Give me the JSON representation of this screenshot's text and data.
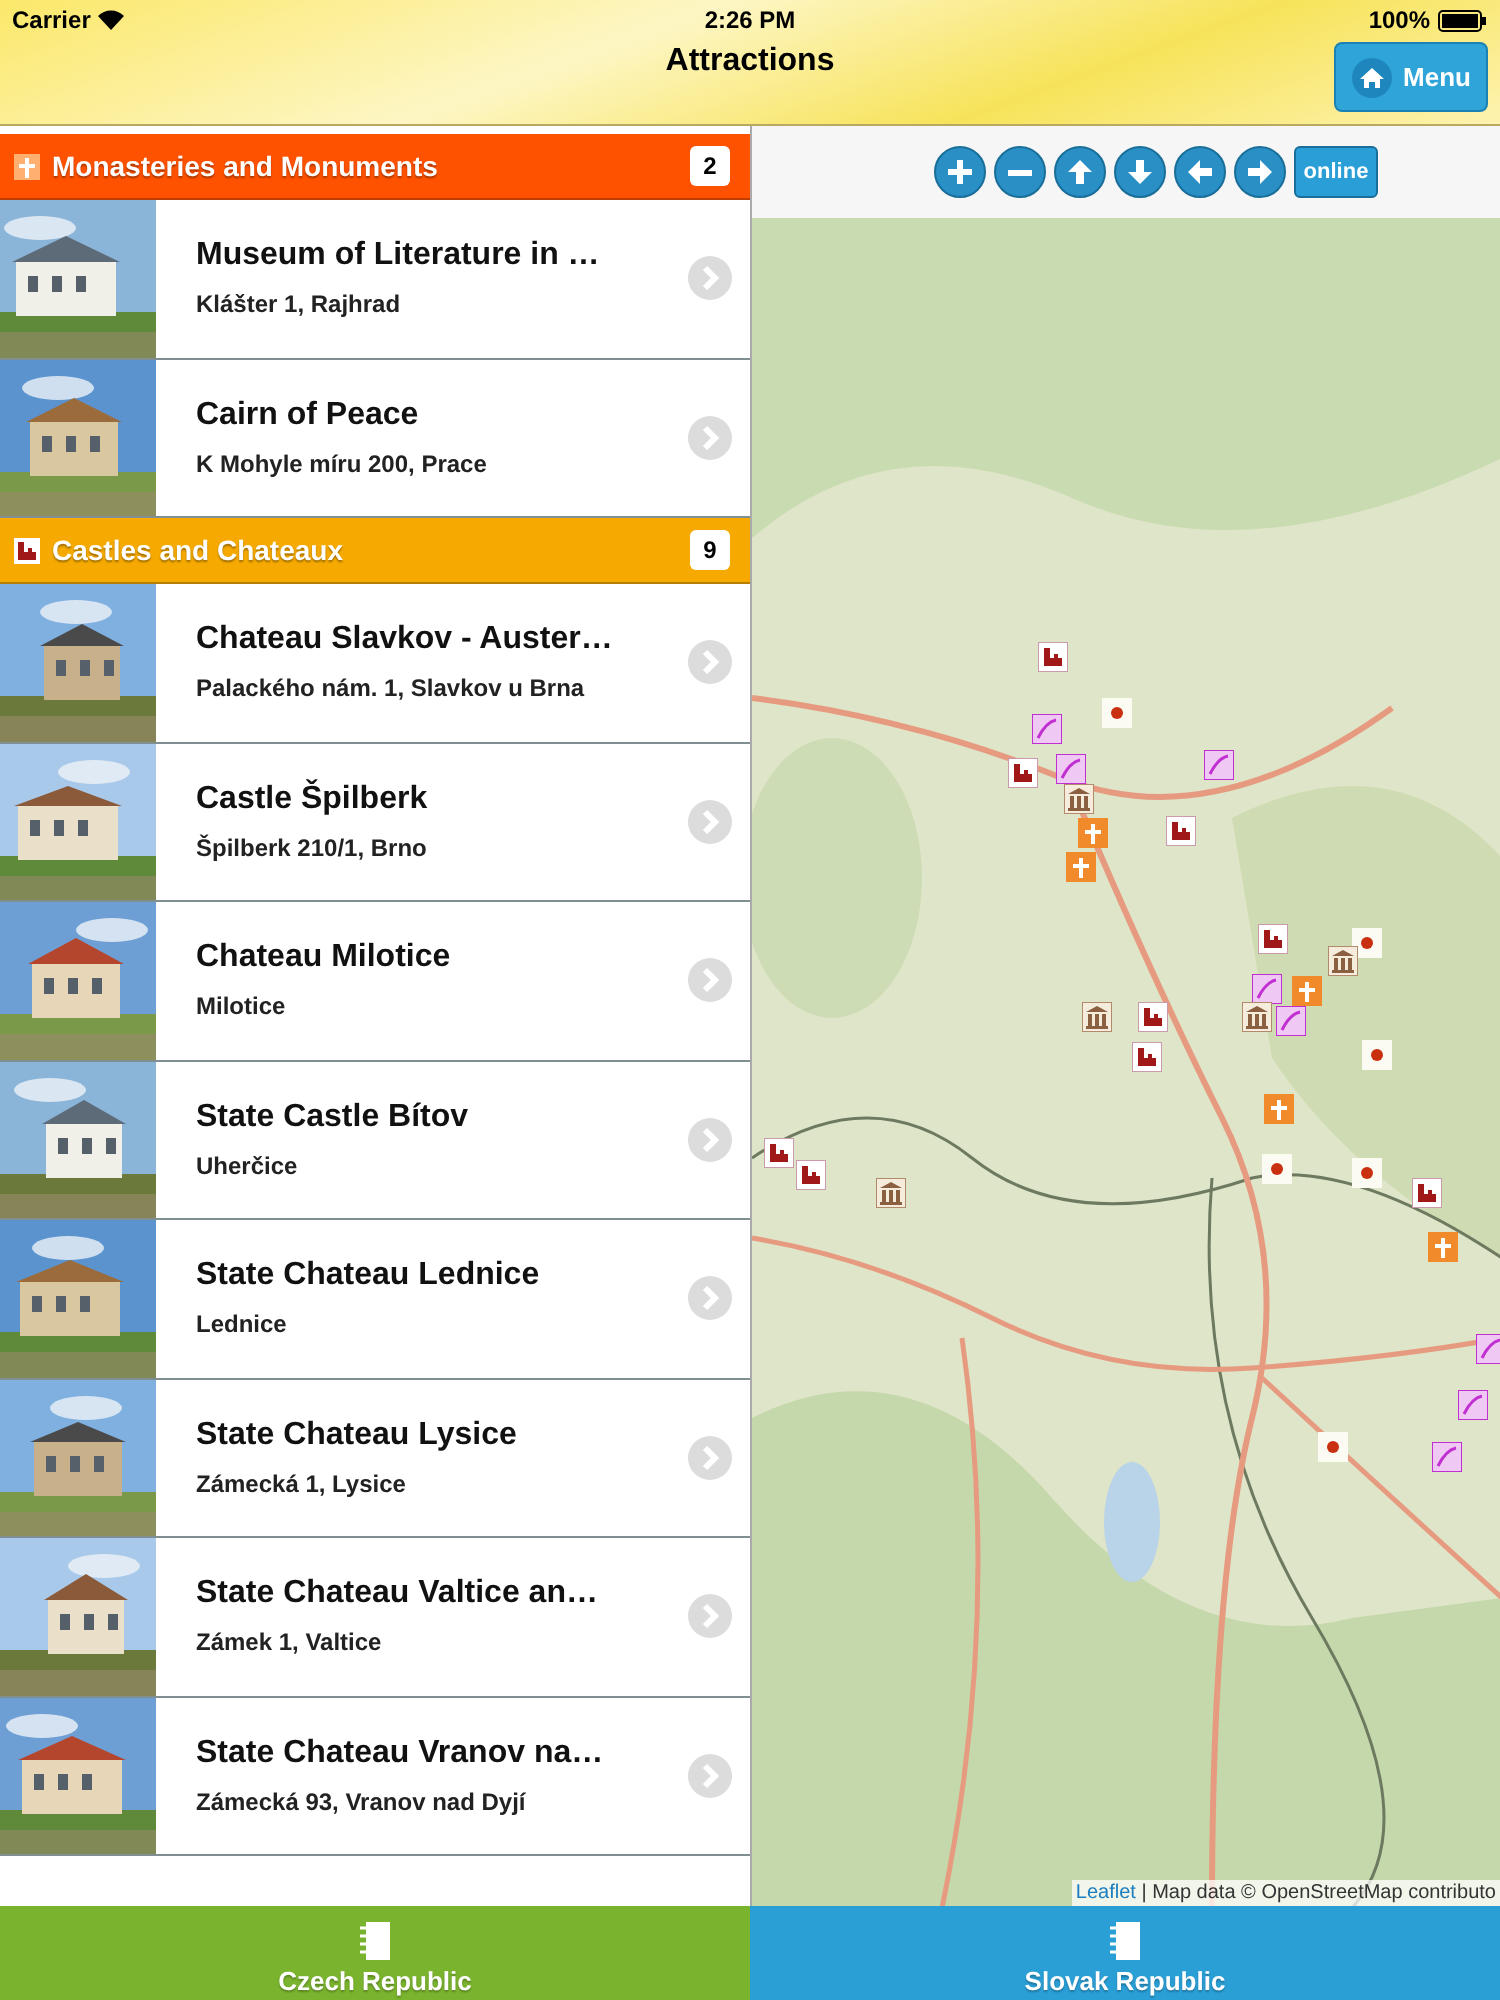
{
  "status_bar": {
    "carrier": "Carrier",
    "time": "2:26 PM",
    "battery": "100%"
  },
  "nav_bar": {
    "title": "Attractions",
    "menu_button": "Menu"
  },
  "sections": [
    {
      "kind": "monastery",
      "title": "Monasteries and Monuments",
      "count": "2",
      "color": "#ff5200",
      "items": [
        {
          "title": "Museum of Literature in …",
          "address": "Klášter 1, Rajhrad"
        },
        {
          "title": "Cairn of Peace",
          "address": "K Mohyle míru 200, Prace"
        }
      ]
    },
    {
      "kind": "castle",
      "title": "Castles and Chateaux",
      "count": "9",
      "color": "#f6a900",
      "items": [
        {
          "title": "Chateau Slavkov - Auster…",
          "address": "Palackého nám. 1, Slavkov u Brna"
        },
        {
          "title": "Castle Špilberk",
          "address": "Špilberk 210/1, Brno"
        },
        {
          "title": "Chateau Milotice",
          "address": "Milotice"
        },
        {
          "title": "State Castle Bítov",
          "address": "Uherčice"
        },
        {
          "title": "State Chateau Lednice",
          "address": "Lednice"
        },
        {
          "title": "State Chateau Lysice",
          "address": "Zámecká 1, Lysice"
        },
        {
          "title": "State Chateau Valtice an…",
          "address": "Zámek 1, Valtice"
        },
        {
          "title": "State Chateau Vranov na…",
          "address": "Zámecká 93, Vranov nad Dyjí"
        }
      ]
    }
  ],
  "map": {
    "online_button": "online",
    "attribution_link": "Leaflet",
    "attribution": "| Map data © OpenStreetMap contributo"
  },
  "tabs": [
    {
      "label": "Czech Republic",
      "color": "#7ab32e"
    },
    {
      "label": "Slovak Republic",
      "color": "#2a9fd6"
    }
  ]
}
